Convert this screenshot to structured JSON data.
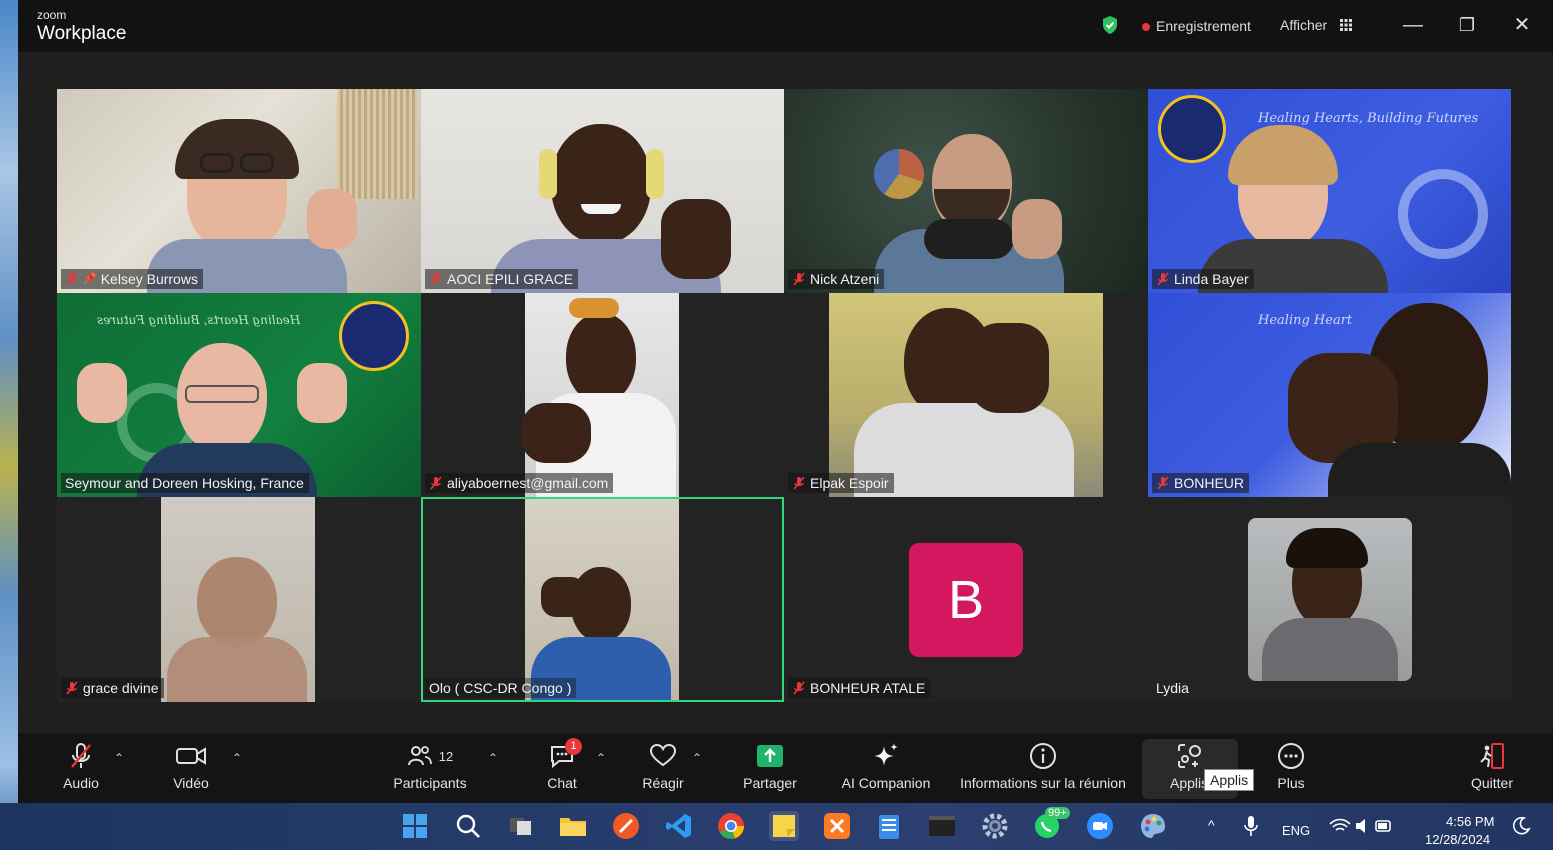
{
  "app": {
    "brand_small": "zoom",
    "brand_big": "Workplace"
  },
  "titlebar": {
    "recording_label": "Enregistrement",
    "view_label": "Afficher",
    "minimize": "—",
    "restore": "❐",
    "close": "✕"
  },
  "participants": [
    {
      "name": "Kelsey Burrows",
      "muted": true,
      "pinned": true
    },
    {
      "name": "AOCI EPILI GRACE",
      "muted": true
    },
    {
      "name": "Nick Atzeni",
      "muted": true
    },
    {
      "name": "Linda Bayer",
      "muted": true
    },
    {
      "name": "Seymour and Doreen Hosking, France",
      "muted": false
    },
    {
      "name": "aliyaboernest@gmail.com",
      "muted": true
    },
    {
      "name": "Elpak Espoir",
      "muted": true
    },
    {
      "name": "BONHEUR",
      "muted": true
    },
    {
      "name": "grace divine",
      "muted": true
    },
    {
      "name": "Olo ( CSC-DR Congo )",
      "muted": false,
      "active_speaker": true
    },
    {
      "name": "BONHEUR ATALE",
      "muted": true,
      "avatar_letter": "B"
    },
    {
      "name": "Lydia",
      "muted": false
    }
  ],
  "backgrounds": {
    "healing_text": "Healing Hearts, Building Futures",
    "healing_short": "Healing Heart"
  },
  "toolbar": {
    "audio": "Audio",
    "video": "Vidéo",
    "participants": "Participants",
    "participants_count": "12",
    "chat": "Chat",
    "chat_badge": "1",
    "react": "Réagir",
    "share": "Partager",
    "ai": "AI Companion",
    "info": "Informations sur la réunion",
    "apps": "Applis",
    "apps_tooltip": "Applis",
    "more": "Plus",
    "quit": "Quitter"
  },
  "taskbar": {
    "whatsapp_badge": "99+",
    "lang": "ENG",
    "time": "4:56 PM",
    "date": "12/28/2024"
  },
  "colors": {
    "active_border": "#2fd67b",
    "avatar_bg": "#d4185f",
    "mic_off": "#e8363a",
    "share_green": "#1fb36b"
  }
}
